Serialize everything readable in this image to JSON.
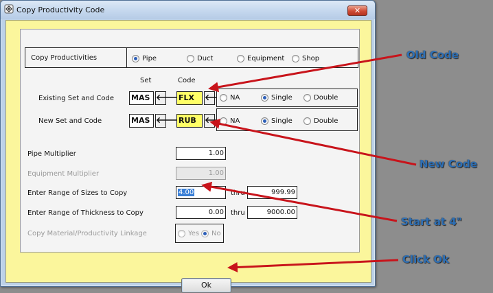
{
  "window": {
    "title": "Copy Productivity Code",
    "close_label": "✕"
  },
  "copy_productivities": {
    "label": "Copy Productivities",
    "options": [
      {
        "label": "Pipe",
        "selected": true
      },
      {
        "label": "Duct",
        "selected": false
      },
      {
        "label": "Equipment",
        "selected": false
      },
      {
        "label": "Shop",
        "selected": false
      }
    ]
  },
  "columns": {
    "set": "Set",
    "code": "Code"
  },
  "existing": {
    "label": "Existing Set and Code",
    "set": "MAS",
    "code": "FLX",
    "arrow": "🡐",
    "options": [
      {
        "label": "NA",
        "selected": false
      },
      {
        "label": "Single",
        "selected": true
      },
      {
        "label": "Double",
        "selected": false
      }
    ]
  },
  "new": {
    "label": "New Set and Code",
    "set": "MAS",
    "code": "RUB",
    "arrow": "🡐",
    "options": [
      {
        "label": "NA",
        "selected": false
      },
      {
        "label": "Single",
        "selected": true
      },
      {
        "label": "Double",
        "selected": false
      }
    ]
  },
  "pipe_multiplier": {
    "label": "Pipe Multiplier",
    "value": "1.00"
  },
  "equipment_multiplier": {
    "label": "Equipment Multiplier",
    "value": "1.00"
  },
  "sizes": {
    "label": "Enter Range of Sizes to Copy",
    "from": "4.00",
    "thru_label": "thru",
    "to": "999.99"
  },
  "thickness": {
    "label": "Enter Range of Thickness to Copy",
    "from": "0.00",
    "thru_label": "thru",
    "to": "9000.00"
  },
  "linkage": {
    "label": "Copy Material/Productivity Linkage",
    "options": [
      {
        "label": "Yes",
        "selected": false
      },
      {
        "label": "No",
        "selected": true
      }
    ]
  },
  "ok_button": "Ok",
  "annotations": {
    "old_code": "Old Code",
    "new_code": "New Code",
    "start_at": "Start at 4\"",
    "click_ok": "Click Ok"
  },
  "colors": {
    "annotation": "#2e6fb4",
    "arrow": "#c8141b",
    "dialog_bg": "#fbf69c",
    "highlight": "#ffff66"
  }
}
